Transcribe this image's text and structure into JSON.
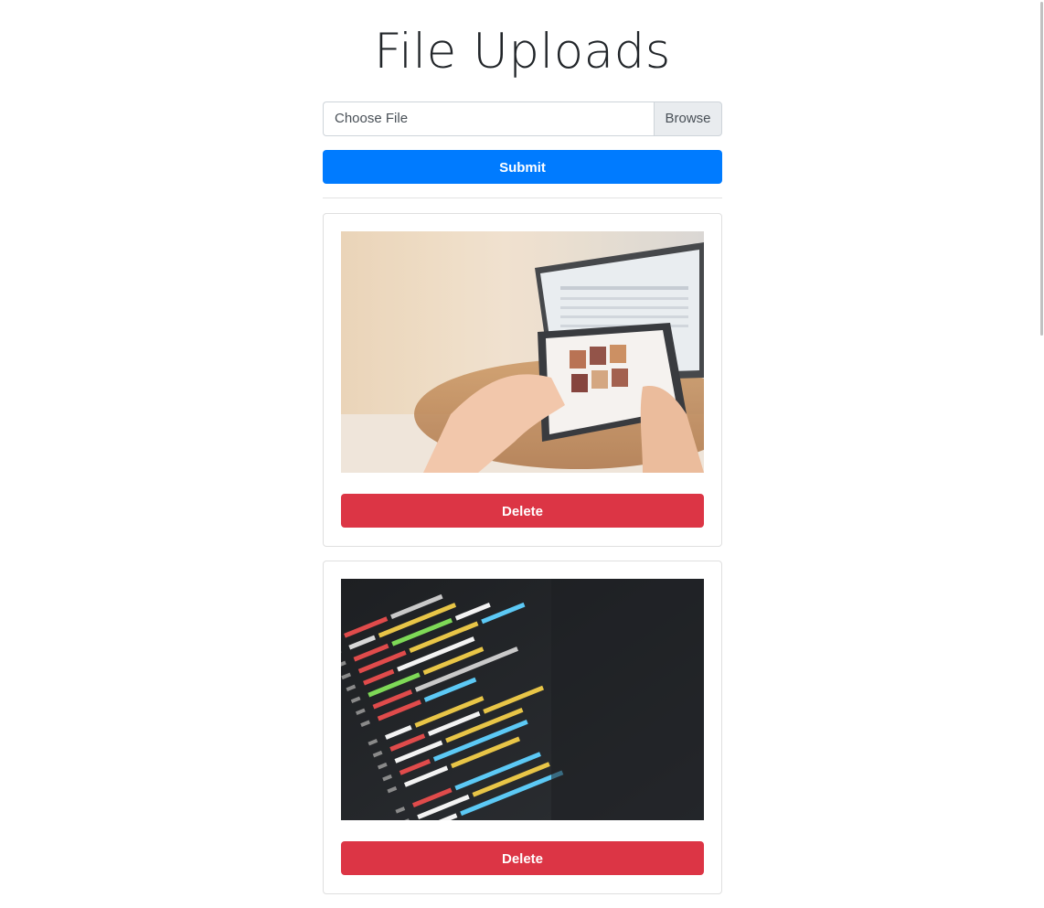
{
  "page": {
    "title": "File Uploads"
  },
  "upload": {
    "file_placeholder": "Choose File",
    "browse_label": "Browse",
    "submit_label": "Submit"
  },
  "uploads": [
    {
      "delete_label": "Delete"
    },
    {
      "delete_label": "Delete"
    }
  ],
  "colors": {
    "primary": "#007bff",
    "danger": "#dc3545",
    "browse_bg": "#e9ecef",
    "border": "#ced4da"
  }
}
